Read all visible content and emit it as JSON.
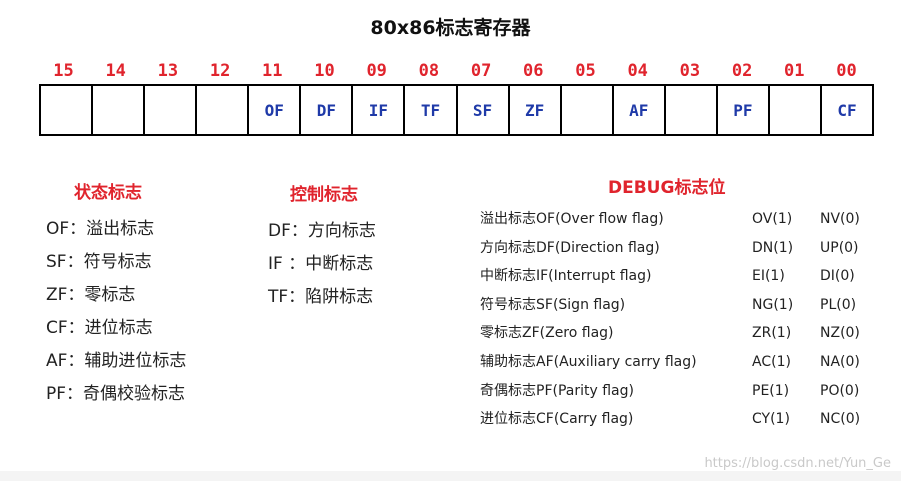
{
  "title": "80x86标志寄存器",
  "bit_numbers": [
    "15",
    "14",
    "13",
    "12",
    "11",
    "10",
    "09",
    "08",
    "07",
    "06",
    "05",
    "04",
    "03",
    "02",
    "01",
    "00"
  ],
  "register_cells": [
    "",
    "",
    "",
    "",
    "OF",
    "DF",
    "IF",
    "TF",
    "SF",
    "ZF",
    "",
    "AF",
    "",
    "PF",
    "",
    "CF"
  ],
  "status_section": {
    "title": "状态标志",
    "items": [
      "OF：溢出标志",
      "SF：符号标志",
      "ZF：零标志",
      "CF：进位标志",
      "AF：辅助进位标志",
      "PF：奇偶校验标志"
    ]
  },
  "control_section": {
    "title": "控制标志",
    "items": [
      "DF：方向标志",
      "IF  ：中断标志",
      "TF：陷阱标志"
    ]
  },
  "debug_section": {
    "title": "DEBUG标志位",
    "rows": [
      {
        "name": "溢出标志OF(Over flow flag)",
        "set": "OV(1)",
        "clear": "NV(0)"
      },
      {
        "name": "方向标志DF(Direction flag)",
        "set": "DN(1)",
        "clear": "UP(0)"
      },
      {
        "name": "中断标志IF(Interrupt flag)",
        "set": "EI(1)",
        "clear": "DI(0)"
      },
      {
        "name": "符号标志SF(Sign flag)",
        "set": "NG(1)",
        "clear": "PL(0)"
      },
      {
        "name": "零标志ZF(Zero flag)",
        "set": "ZR(1)",
        "clear": "NZ(0)"
      },
      {
        "name": "辅助标志AF(Auxiliary carry flag)",
        "set": "AC(1)",
        "clear": "NA(0)"
      },
      {
        "name": "奇偶标志PF(Parity flag)",
        "set": "PE(1)",
        "clear": "PO(0)"
      },
      {
        "name": "进位标志CF(Carry flag)",
        "set": "CY(1)",
        "clear": "NC(0)"
      }
    ]
  },
  "watermark": "https://blog.csdn.net/Yun_Ge",
  "colors": {
    "accent_red": "#e0242d",
    "flag_blue": "#1f3aa8"
  }
}
